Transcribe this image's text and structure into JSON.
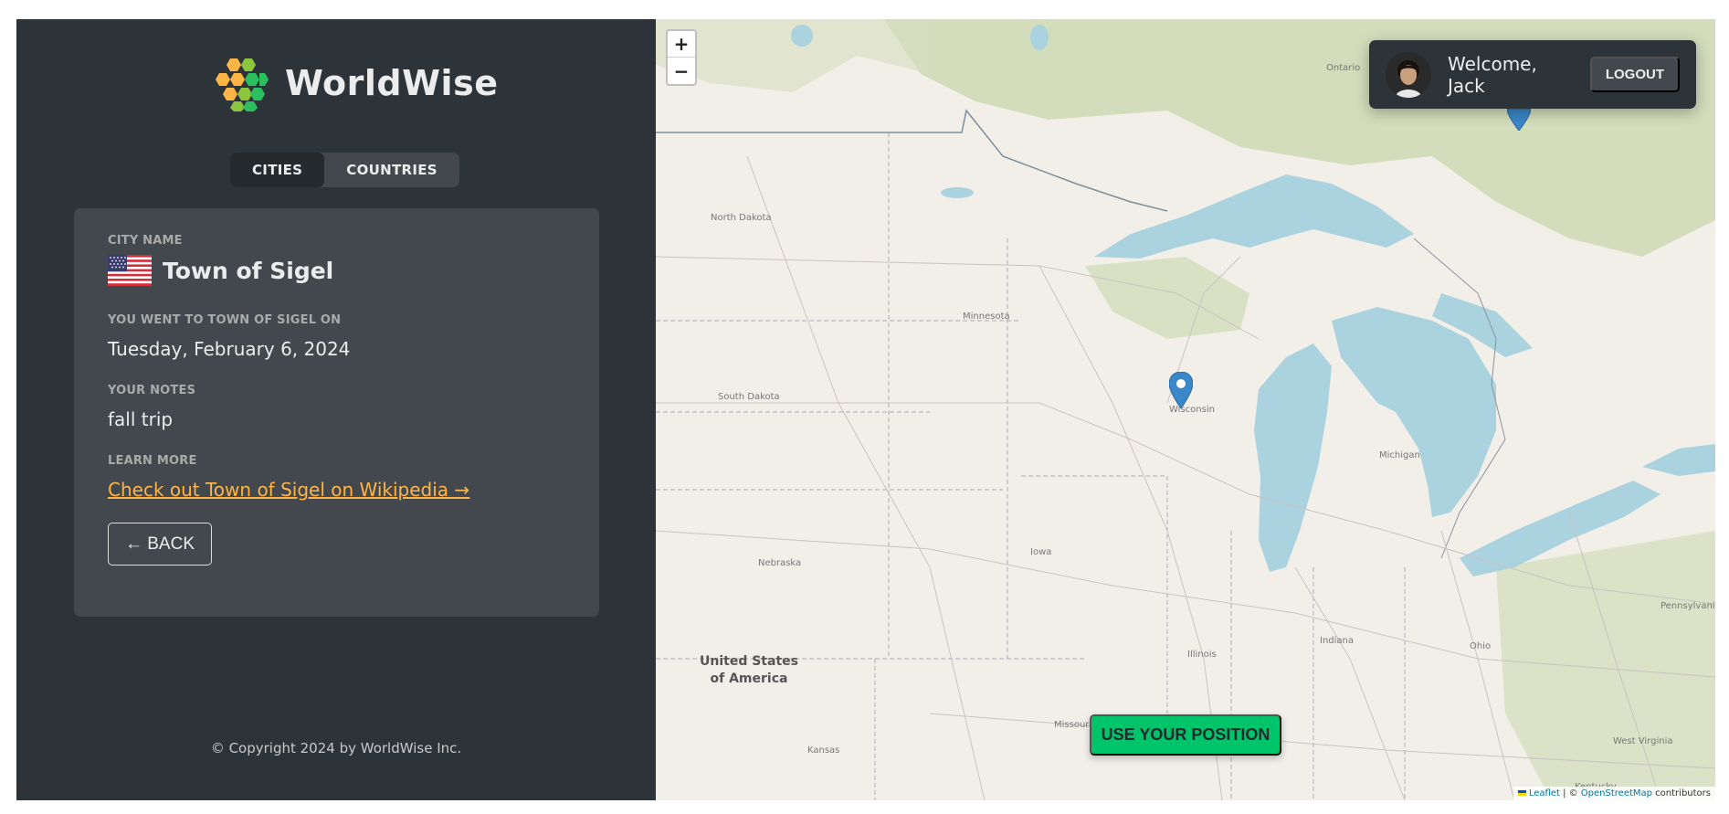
{
  "brand": {
    "name": "WorldWise"
  },
  "tabs": [
    {
      "label": "CITIES",
      "active": true
    },
    {
      "label": "COUNTRIES",
      "active": false
    }
  ],
  "city": {
    "name_label": "CITY NAME",
    "flag_icon": "us-flag-icon",
    "name": "Town of Sigel",
    "date_label": "YOU WENT TO TOWN OF SIGEL ON",
    "date": "Tuesday, February 6, 2024",
    "notes_label": "YOUR NOTES",
    "notes": "fall trip",
    "learn_label": "LEARN MORE",
    "wiki_link": "Check out Town of Sigel on Wikipedia →",
    "back_label": "← BACK"
  },
  "footer": {
    "copyright": "© Copyright 2024 by WorldWise Inc."
  },
  "map": {
    "zoom_in": "+",
    "zoom_out": "−",
    "user": {
      "welcome": "Welcome, Jack",
      "logout": "LOGOUT"
    },
    "use_position": "USE YOUR POSITION",
    "attribution": {
      "leaflet": "Leaflet",
      "sep": " | © ",
      "osm": "OpenStreetMap",
      "suffix": " contributors"
    },
    "labels": {
      "ontario": "Ontario",
      "north_dakota": "North Dakota",
      "minnesota": "Minnesota",
      "south_dakota": "South Dakota",
      "wisconsin": "Wisconsin",
      "michigan": "Michigan",
      "iowa": "Iowa",
      "nebraska": "Nebraska",
      "illinois": "Illinois",
      "indiana": "Indiana",
      "ohio": "Ohio",
      "pennsylvania": "Pennsylvani",
      "missouri": "Missouri",
      "kansas": "Kansas",
      "kentucky": "Kentucky",
      "west_virginia": "West Virginia",
      "usa_line1": "United States",
      "usa_line2": "of America"
    },
    "colors": {
      "water": "#aad3df",
      "land": "#f2efe9",
      "forest": "#c8d7ab",
      "accent": "#00c46a",
      "link": "#ffb545"
    }
  }
}
